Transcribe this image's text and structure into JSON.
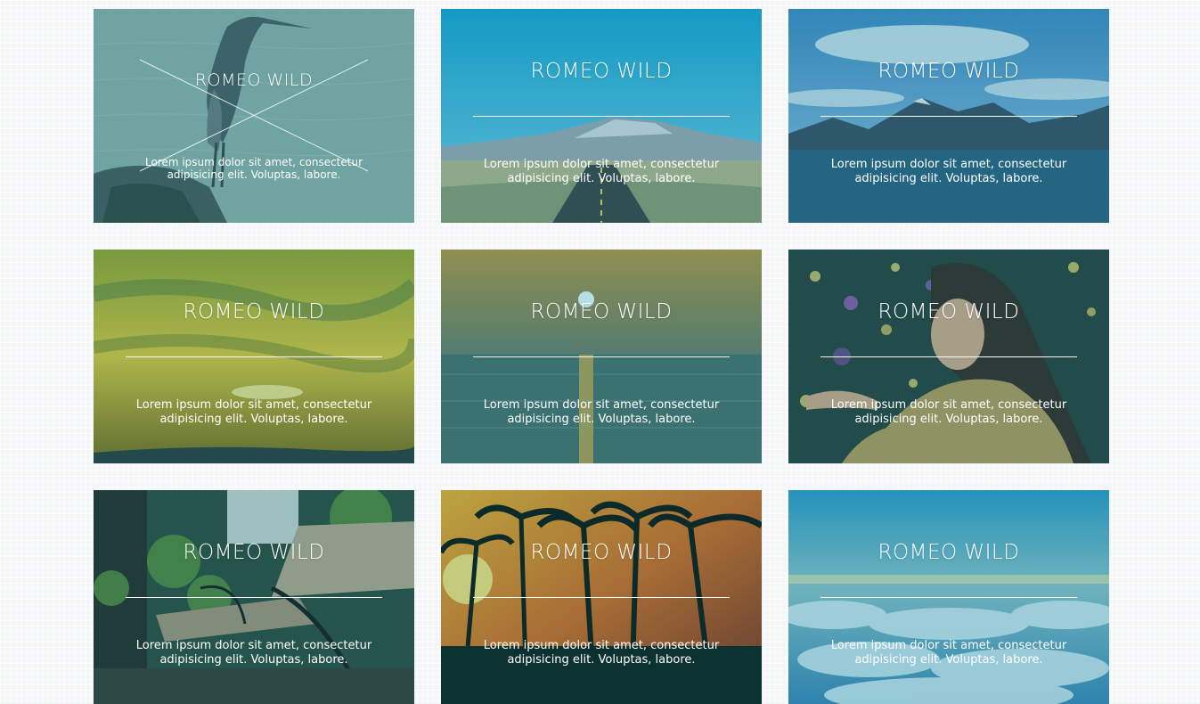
{
  "cards": [
    {
      "title": "ROMEO WILD",
      "text": "Lorem ipsum dolor sit amet, consectetur adipisicing elit. Voluptas, labore.",
      "image": "heron-on-rock",
      "tint": "#6f9f9a"
    },
    {
      "title": "ROMEO WILD",
      "text": "Lorem ipsum dolor sit amet, consectetur adipisicing elit. Voluptas, labore.",
      "image": "desert-road-mountain",
      "tint": "#1aa0cc"
    },
    {
      "title": "ROMEO WILD",
      "text": "Lorem ipsum dolor sit amet, consectetur adipisicing elit. Voluptas, labore.",
      "image": "mountain-lake",
      "tint": "#2a6f95"
    },
    {
      "title": "ROMEO WILD",
      "text": "Lorem ipsum dolor sit amet, consectetur adipisicing elit. Voluptas, labore.",
      "image": "golden-sky-sunset",
      "tint": "#8a9a2a"
    },
    {
      "title": "ROMEO WILD",
      "text": "Lorem ipsum dolor sit amet, consectetur adipisicing elit. Voluptas, labore.",
      "image": "sea-sunset",
      "tint": "#4d7a78"
    },
    {
      "title": "ROMEO WILD",
      "text": "Lorem ipsum dolor sit amet, consectetur adipisicing elit. Voluptas, labore.",
      "image": "woman-sequin-bokeh",
      "tint": "#2f4a44"
    },
    {
      "title": "ROMEO WILD",
      "text": "Lorem ipsum dolor sit amet, consectetur adipisicing elit. Voluptas, labore.",
      "image": "garden-bench",
      "tint": "#3a5a45"
    },
    {
      "title": "ROMEO WILD",
      "text": "Lorem ipsum dolor sit amet, consectetur adipisicing elit. Voluptas, labore.",
      "image": "palm-sunset",
      "tint": "#7a3a1e"
    },
    {
      "title": "ROMEO WILD",
      "text": "Lorem ipsum dolor sit amet, consectetur adipisicing elit. Voluptas, labore.",
      "image": "sky-clouds",
      "tint": "#3a8fb8"
    }
  ]
}
